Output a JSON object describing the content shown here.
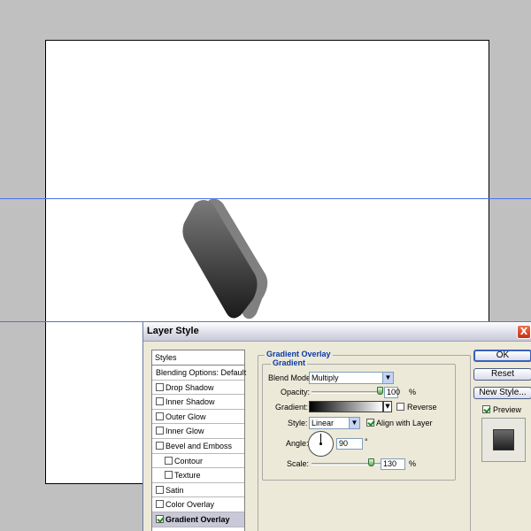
{
  "dialog": {
    "title": "Layer Style",
    "close_glyph": "X"
  },
  "styles_list": {
    "header": "Styles",
    "items": [
      {
        "label": "Blending Options: Default",
        "checkbox": false,
        "checked": false
      },
      {
        "label": "Drop Shadow",
        "checkbox": true,
        "checked": false
      },
      {
        "label": "Inner Shadow",
        "checkbox": true,
        "checked": false
      },
      {
        "label": "Outer Glow",
        "checkbox": true,
        "checked": false
      },
      {
        "label": "Inner Glow",
        "checkbox": true,
        "checked": false
      },
      {
        "label": "Bevel and Emboss",
        "checkbox": true,
        "checked": false
      },
      {
        "label": "Contour",
        "checkbox": true,
        "checked": false
      },
      {
        "label": "Texture",
        "checkbox": true,
        "checked": false
      },
      {
        "label": "Satin",
        "checkbox": true,
        "checked": false
      },
      {
        "label": "Color Overlay",
        "checkbox": true,
        "checked": false
      },
      {
        "label": "Gradient Overlay",
        "checkbox": true,
        "checked": true
      }
    ]
  },
  "gradient_overlay": {
    "section_title": "Gradient Overlay",
    "group_title": "Gradient",
    "blend_mode_label": "Blend Mode:",
    "blend_mode_value": "Multiply",
    "opacity_label": "Opacity:",
    "opacity_value": "100",
    "opacity_unit": "%",
    "opacity_fraction": 1.0,
    "gradient_label": "Gradient:",
    "reverse_label": "Reverse",
    "reverse_checked": false,
    "style_label": "Style:",
    "style_value": "Linear",
    "align_label": "Align with Layer",
    "align_checked": true,
    "angle_label": "Angle:",
    "angle_value": "90",
    "angle_unit": "°",
    "scale_label": "Scale:",
    "scale_value": "130",
    "scale_unit": "%",
    "scale_fraction": 0.87
  },
  "buttons": {
    "ok": "OK",
    "reset": "Reset",
    "new_style": "New Style...",
    "preview_label": "Preview",
    "preview_checked": true
  },
  "colors": {
    "guide": "#4a72e8",
    "shape_back": "#808080",
    "shape_front_top": "#7a7a7a",
    "shape_front_bottom": "#1a1a1a",
    "workspace": "#c0c0c0"
  }
}
